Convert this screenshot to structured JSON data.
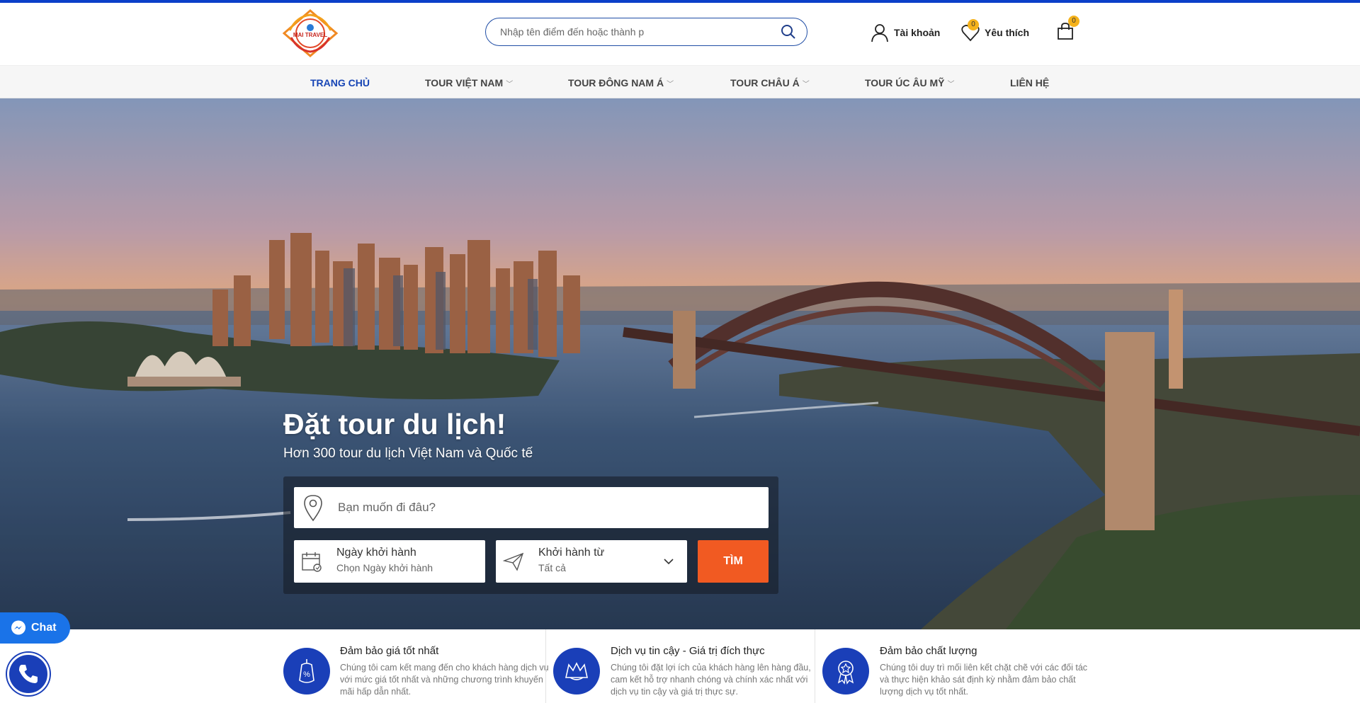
{
  "brand": {
    "logo_text": "MAI TRAVEL",
    "accent": "#1745b5",
    "cta": "#f15a22"
  },
  "header": {
    "search_placeholder": "Nhập tên điểm đến hoặc thành p",
    "account_label": "Tài khoản",
    "wishlist_label": "Yêu thích",
    "wishlist_count": "0",
    "cart_count": "0"
  },
  "nav": {
    "items": [
      {
        "label": "TRANG CHỦ",
        "dropdown": false,
        "active": true
      },
      {
        "label": "TOUR VIỆT NAM",
        "dropdown": true
      },
      {
        "label": "TOUR ĐÔNG NAM Á",
        "dropdown": true
      },
      {
        "label": "TOUR CHÂU Á",
        "dropdown": true
      },
      {
        "label": "TOUR ÚC ÂU MỸ",
        "dropdown": true
      },
      {
        "label": "LIÊN HỆ",
        "dropdown": false
      }
    ]
  },
  "hero": {
    "title": "Đặt tour du lịch!",
    "subtitle": "Hơn 300 tour du lịch Việt Nam và Quốc tế",
    "destination_placeholder": "Bạn muốn đi đâu?",
    "date_label": "Ngày khởi hành",
    "date_value": "Chọn Ngày khởi hành",
    "from_label": "Khởi hành từ",
    "from_value": "Tất cả",
    "search_button": "TÌM"
  },
  "features": [
    {
      "title": "Đảm bảo giá tốt nhất",
      "text": "Chúng tôi cam kết mang đến cho khách hàng dịch vụ với mức giá tốt nhất và những chương trình khuyến mãi hấp dẫn nhất.",
      "icon": "price-tag-icon"
    },
    {
      "title": "Dịch vụ tin cậy - Giá trị đích thực",
      "text": "Chúng tôi đặt lợi ích của khách hàng lên hàng đầu, cam kết hỗ trợ nhanh chóng và chính xác nhất với dịch vụ tin cậy và giá trị thực sự.",
      "icon": "handshake-icon"
    },
    {
      "title": "Đảm bảo chất lượng",
      "text": "Chúng tôi duy trì mối liên kết chặt chẽ với các đối tác và thực hiện khảo sát định kỳ nhằm đảm bảo chất lượng dịch vụ tốt nhất.",
      "icon": "award-icon"
    }
  ],
  "floating": {
    "chat_label": "Chat"
  }
}
